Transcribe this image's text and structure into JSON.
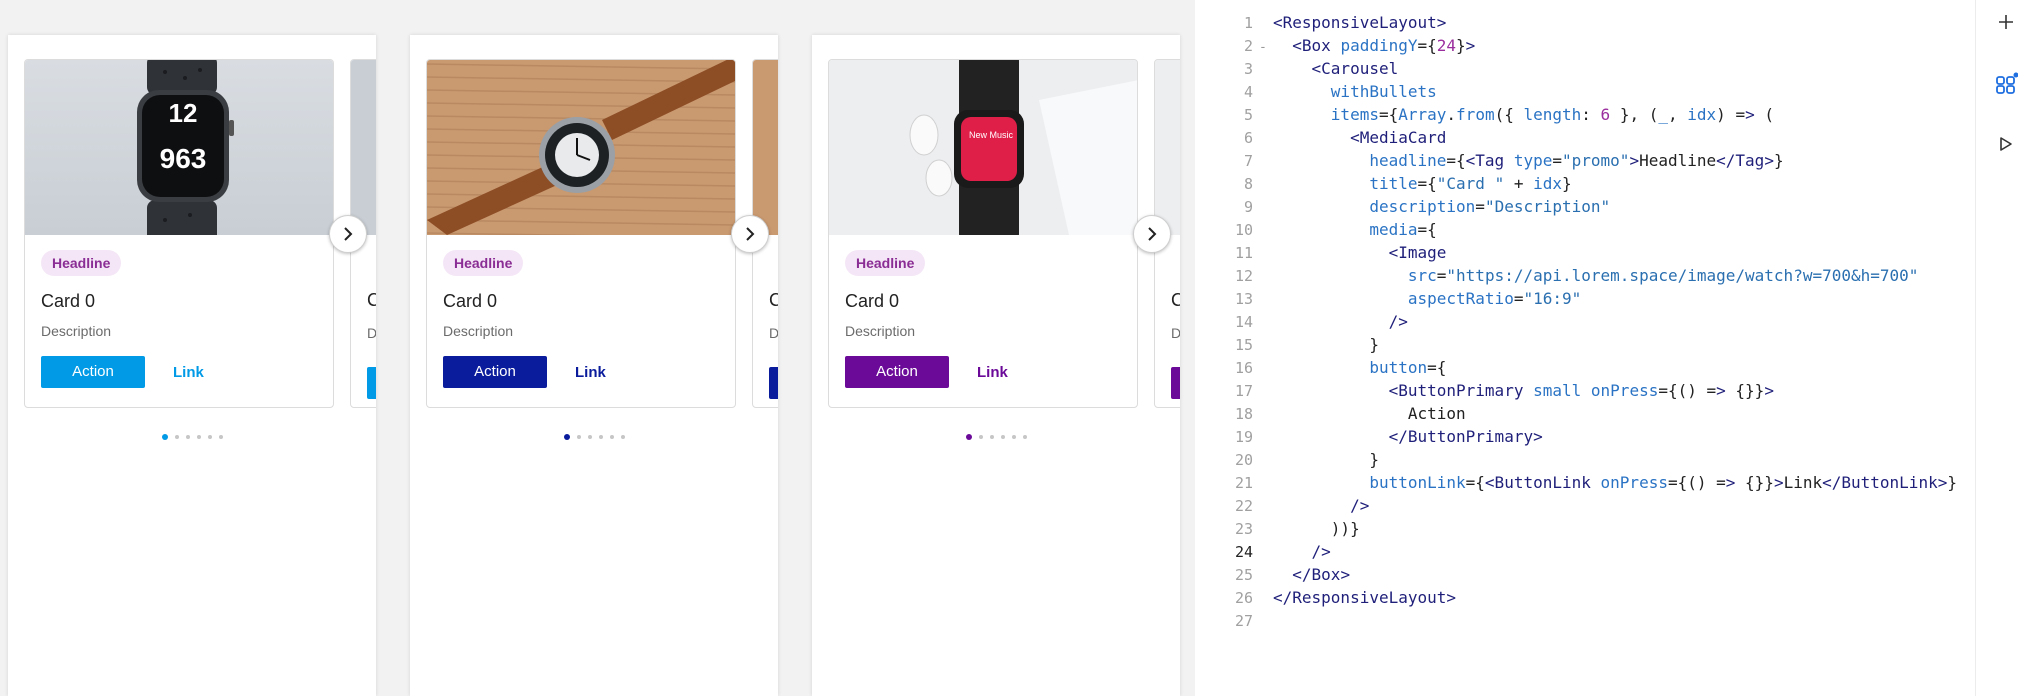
{
  "preview": {
    "frames": [
      {
        "accent": "#009ae6",
        "image": "watch-dark",
        "tag": "Headline",
        "title": "Card 0",
        "description": "Description",
        "button": "Action",
        "link": "Link",
        "peek_title": "C",
        "peek_desc": "D"
      },
      {
        "accent": "#0a1c9c",
        "image": "watch-leather",
        "tag": "Headline",
        "title": "Card 0",
        "description": "Description",
        "button": "Action",
        "link": "Link",
        "peek_title": "C",
        "peek_desc": "D"
      },
      {
        "accent": "#6b0a99",
        "image": "watch-airpods",
        "tag": "Headline",
        "title": "Card 0",
        "description": "Description",
        "button": "Action",
        "link": "Link",
        "peek_title": "C",
        "peek_desc": "D"
      }
    ],
    "dots_count": 6,
    "active_dot": 0
  },
  "editor": {
    "current_line": 24,
    "lines": [
      {
        "n": "1",
        "text": "<ResponsiveLayout>"
      },
      {
        "n": "2",
        "text": "  <Box paddingY={24}>",
        "fold": "-"
      },
      {
        "n": "3",
        "text": "    <Carousel"
      },
      {
        "n": "4",
        "text": "      withBullets"
      },
      {
        "n": "5",
        "text": "      items={Array.from({ length: 6 }, (_, idx) => ("
      },
      {
        "n": "6",
        "text": "        <MediaCard"
      },
      {
        "n": "7",
        "text": "          headline={<Tag type=\"promo\">Headline</Tag>}"
      },
      {
        "n": "8",
        "text": "          title={\"Card \" + idx}"
      },
      {
        "n": "9",
        "text": "          description=\"Description\""
      },
      {
        "n": "10",
        "text": "          media={"
      },
      {
        "n": "11",
        "text": "            <Image"
      },
      {
        "n": "12",
        "text": "              src=\"https://api.lorem.space/image/watch?w=700&h=700\""
      },
      {
        "n": "13",
        "text": "              aspectRatio=\"16:9\""
      },
      {
        "n": "14",
        "text": "            />"
      },
      {
        "n": "15",
        "text": "          }"
      },
      {
        "n": "16",
        "text": "          button={"
      },
      {
        "n": "17",
        "text": "            <ButtonPrimary small onPress={() => {}}>"
      },
      {
        "n": "18",
        "text": "              Action"
      },
      {
        "n": "19",
        "text": "            </ButtonPrimary>"
      },
      {
        "n": "20",
        "text": "          }"
      },
      {
        "n": "21",
        "text": "          buttonLink={<ButtonLink onPress={() => {}}>Link</ButtonLink>}"
      },
      {
        "n": "22",
        "text": "        />"
      },
      {
        "n": "23",
        "text": "      ))}"
      },
      {
        "n": "24",
        "text": "    />"
      },
      {
        "n": "25",
        "text": "  </Box>"
      },
      {
        "n": "26",
        "text": "</ResponsiveLayout>"
      },
      {
        "n": "27",
        "text": ""
      }
    ]
  },
  "toolbar": {
    "items": [
      {
        "icon": "plus-icon"
      },
      {
        "icon": "components-icon",
        "badge": true
      },
      {
        "icon": "play-icon"
      }
    ],
    "accent": "#1f6fe0"
  }
}
